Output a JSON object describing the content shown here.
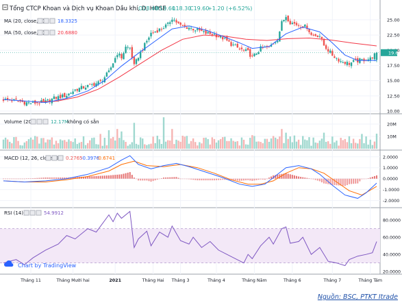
{
  "chart_data": [
    {
      "type": "candlestick",
      "name": "price",
      "title": "Tổng CTCP Khoan và Dịch vụ Khoan Dầu khí, D, HOSE",
      "ohlc_header": {
        "open": "O18.40",
        "high": "H19.60",
        "low": "L18.30",
        "close": "C19.60",
        "change": "+1.20 (+6.52%)"
      },
      "ma_labels": [
        {
          "label": "MA (20, close, 0)",
          "value": "18.3325",
          "color": "#2962ff"
        },
        {
          "label": "MA (50, close, 0)",
          "value": "20.6880",
          "color": "#f23645"
        }
      ],
      "yticks": [
        "25.00",
        "22.50",
        "20.00",
        "17.50",
        "15.00",
        "12.50",
        "10.00"
      ],
      "ylim": [
        10,
        26
      ],
      "last_price_label": "19.60",
      "anchors": [
        [
          0,
          11.9
        ],
        [
          6,
          11.7
        ],
        [
          10,
          11.4
        ],
        [
          14,
          11.3
        ],
        [
          20,
          11.5
        ],
        [
          24,
          12.1
        ],
        [
          30,
          12.6
        ],
        [
          34,
          13.5
        ],
        [
          38,
          13.9
        ],
        [
          42,
          14.3
        ],
        [
          46,
          14.8
        ],
        [
          50,
          16.4
        ],
        [
          54,
          19.5
        ],
        [
          56,
          18.8
        ],
        [
          58,
          20.5
        ],
        [
          60,
          20.4
        ],
        [
          62,
          17.4
        ],
        [
          64,
          19.0
        ],
        [
          66,
          20.2
        ],
        [
          70,
          22.8
        ],
        [
          74,
          23.4
        ],
        [
          78,
          24.2
        ],
        [
          80,
          25.3
        ],
        [
          84,
          24.0
        ],
        [
          88,
          23.7
        ],
        [
          92,
          23.3
        ],
        [
          96,
          22.8
        ],
        [
          100,
          22.6
        ],
        [
          104,
          22.0
        ],
        [
          108,
          21.0
        ],
        [
          112,
          20.2
        ],
        [
          116,
          19.7
        ],
        [
          118,
          18.8
        ],
        [
          122,
          20.3
        ],
        [
          126,
          20.5
        ],
        [
          130,
          21.8
        ],
        [
          132,
          24.5
        ],
        [
          134,
          25.6
        ],
        [
          136,
          24.6
        ],
        [
          140,
          24.1
        ],
        [
          144,
          23.8
        ],
        [
          146,
          22.5
        ],
        [
          150,
          22.4
        ],
        [
          152,
          20.8
        ],
        [
          156,
          19.2
        ],
        [
          160,
          18.2
        ],
        [
          164,
          17.8
        ],
        [
          166,
          18.1
        ],
        [
          170,
          18.4
        ],
        [
          174,
          18.6
        ],
        [
          177,
          19.6
        ]
      ],
      "ma20": [
        [
          0,
          11.9
        ],
        [
          20,
          11.4
        ],
        [
          30,
          12.1
        ],
        [
          40,
          13.3
        ],
        [
          48,
          15.0
        ],
        [
          56,
          17.4
        ],
        [
          64,
          19.5
        ],
        [
          72,
          21.5
        ],
        [
          80,
          23.5
        ],
        [
          88,
          24.0
        ],
        [
          96,
          23.3
        ],
        [
          104,
          22.3
        ],
        [
          112,
          21.2
        ],
        [
          118,
          20.3
        ],
        [
          126,
          20.6
        ],
        [
          134,
          22.7
        ],
        [
          142,
          23.8
        ],
        [
          150,
          23.0
        ],
        [
          156,
          21.2
        ],
        [
          162,
          19.2
        ],
        [
          168,
          18.3
        ],
        [
          177,
          18.3
        ]
      ],
      "ma50": [
        [
          15,
          11.5
        ],
        [
          25,
          11.6
        ],
        [
          35,
          12.3
        ],
        [
          45,
          13.6
        ],
        [
          55,
          15.6
        ],
        [
          65,
          17.8
        ],
        [
          75,
          20.0
        ],
        [
          85,
          21.8
        ],
        [
          95,
          22.5
        ],
        [
          105,
          22.3
        ],
        [
          115,
          21.8
        ],
        [
          125,
          21.6
        ],
        [
          135,
          21.9
        ],
        [
          145,
          22.0
        ],
        [
          155,
          21.7
        ],
        [
          165,
          21.2
        ],
        [
          177,
          20.7
        ]
      ]
    },
    {
      "type": "bar",
      "name": "volume",
      "title": "Volume (20)",
      "value_label": "12.17M",
      "note": "không có sẵn",
      "yticks": [
        "20M",
        "10M"
      ],
      "ylim": [
        0,
        25
      ],
      "base": 6.5,
      "spikes": [
        [
          46,
          12
        ],
        [
          50,
          15
        ],
        [
          54,
          16
        ],
        [
          56,
          14
        ],
        [
          62,
          21
        ],
        [
          76,
          25.5
        ],
        [
          80,
          16
        ],
        [
          96,
          9
        ],
        [
          118,
          11
        ],
        [
          132,
          16
        ],
        [
          134,
          13
        ],
        [
          152,
          13
        ],
        [
          170,
          12
        ],
        [
          177,
          12.2
        ]
      ]
    },
    {
      "type": "line",
      "name": "macd",
      "title": "MACD (12, 26, close, 9)",
      "values_label": [
        "0.2765",
        "-0.3976",
        "-0.6741"
      ],
      "yticks": [
        "2.0000",
        "1.0000",
        "0.0000",
        "-1.0000",
        "-2.0000"
      ],
      "ylim": [
        -2.4,
        2.3
      ],
      "macd": [
        [
          0,
          -0.2
        ],
        [
          10,
          -0.3
        ],
        [
          20,
          -0.2
        ],
        [
          30,
          0.0
        ],
        [
          40,
          0.4
        ],
        [
          50,
          1.0
        ],
        [
          56,
          1.7
        ],
        [
          60,
          2.1
        ],
        [
          64,
          1.3
        ],
        [
          70,
          0.9
        ],
        [
          76,
          1.2
        ],
        [
          82,
          1.4
        ],
        [
          88,
          1.1
        ],
        [
          96,
          0.6
        ],
        [
          104,
          0.1
        ],
        [
          112,
          -0.5
        ],
        [
          118,
          -0.7
        ],
        [
          124,
          -0.5
        ],
        [
          128,
          0.1
        ],
        [
          134,
          1.0
        ],
        [
          140,
          1.2
        ],
        [
          146,
          0.9
        ],
        [
          150,
          0.4
        ],
        [
          156,
          -0.6
        ],
        [
          162,
          -1.5
        ],
        [
          168,
          -1.8
        ],
        [
          172,
          -1.3
        ],
        [
          177,
          -0.4
        ]
      ],
      "signal": [
        [
          0,
          -0.2
        ],
        [
          10,
          -0.3
        ],
        [
          20,
          -0.3
        ],
        [
          30,
          -0.1
        ],
        [
          40,
          0.2
        ],
        [
          50,
          0.7
        ],
        [
          56,
          1.3
        ],
        [
          62,
          1.6
        ],
        [
          68,
          1.2
        ],
        [
          76,
          1.1
        ],
        [
          84,
          1.3
        ],
        [
          92,
          1.0
        ],
        [
          100,
          0.5
        ],
        [
          108,
          -0.1
        ],
        [
          116,
          -0.5
        ],
        [
          122,
          -0.5
        ],
        [
          128,
          -0.2
        ],
        [
          134,
          0.5
        ],
        [
          140,
          1.0
        ],
        [
          146,
          0.9
        ],
        [
          152,
          0.5
        ],
        [
          158,
          -0.3
        ],
        [
          164,
          -1.1
        ],
        [
          170,
          -1.5
        ],
        [
          177,
          -0.7
        ]
      ]
    },
    {
      "type": "line",
      "name": "rsi",
      "title": "RSI (14)",
      "value_label": "54.9912",
      "yticks": [
        "80.0000",
        "60.0000",
        "40.0000",
        "20.0000"
      ],
      "ylim": [
        17,
        92
      ],
      "band": [
        30,
        70
      ],
      "rsi": [
        [
          0,
          30
        ],
        [
          6,
          34
        ],
        [
          10,
          28
        ],
        [
          14,
          36
        ],
        [
          20,
          45
        ],
        [
          26,
          52
        ],
        [
          30,
          62
        ],
        [
          34,
          58
        ],
        [
          40,
          70
        ],
        [
          44,
          66
        ],
        [
          50,
          86
        ],
        [
          52,
          78
        ],
        [
          54,
          88
        ],
        [
          56,
          82
        ],
        [
          60,
          90
        ],
        [
          62,
          48
        ],
        [
          64,
          58
        ],
        [
          68,
          67
        ],
        [
          70,
          50
        ],
        [
          74,
          66
        ],
        [
          78,
          60
        ],
        [
          80,
          73
        ],
        [
          84,
          56
        ],
        [
          88,
          52
        ],
        [
          90,
          60
        ],
        [
          94,
          48
        ],
        [
          98,
          55
        ],
        [
          102,
          45
        ],
        [
          106,
          40
        ],
        [
          110,
          35
        ],
        [
          114,
          30
        ],
        [
          116,
          40
        ],
        [
          118,
          35
        ],
        [
          122,
          50
        ],
        [
          126,
          60
        ],
        [
          128,
          52
        ],
        [
          132,
          70
        ],
        [
          134,
          72
        ],
        [
          136,
          53
        ],
        [
          140,
          55
        ],
        [
          142,
          60
        ],
        [
          146,
          40
        ],
        [
          150,
          48
        ],
        [
          154,
          32
        ],
        [
          158,
          30
        ],
        [
          162,
          27
        ],
        [
          164,
          34
        ],
        [
          168,
          38
        ],
        [
          172,
          40
        ],
        [
          175,
          42
        ],
        [
          177,
          55
        ]
      ]
    }
  ],
  "x_axis": {
    "n_bars": 178,
    "labels": [
      {
        "i": 13,
        "text": "Tháng 11",
        "bold": false
      },
      {
        "i": 33,
        "text": "Tháng Mười hai",
        "bold": false
      },
      {
        "i": 53,
        "text": "2021",
        "bold": true
      },
      {
        "i": 71,
        "text": "Tháng Hai",
        "bold": false
      },
      {
        "i": 84,
        "text": "Tháng 3",
        "bold": false
      },
      {
        "i": 101,
        "text": "Tháng 4",
        "bold": false
      },
      {
        "i": 119,
        "text": "Tháng Năm",
        "bold": false
      },
      {
        "i": 137,
        "text": "Tháng 6",
        "bold": false
      },
      {
        "i": 156,
        "text": "Tháng 7",
        "bold": false
      },
      {
        "i": 174,
        "text": "Tháng Tám",
        "bold": false
      }
    ]
  },
  "watermark": "Chart by TradingView",
  "source": "Nguồn: BSC, PTKT Itrade",
  "colors": {
    "up": "#26a69a",
    "down": "#ef5350",
    "ma20": "#2962ff",
    "ma50": "#f23645",
    "macd": "#2962ff",
    "signal": "#ff6d00",
    "rsi": "#7e57c2",
    "rsi_band": "#f3e8f7",
    "grid": "#f0f3fa",
    "price_tag": "#26a69a"
  }
}
